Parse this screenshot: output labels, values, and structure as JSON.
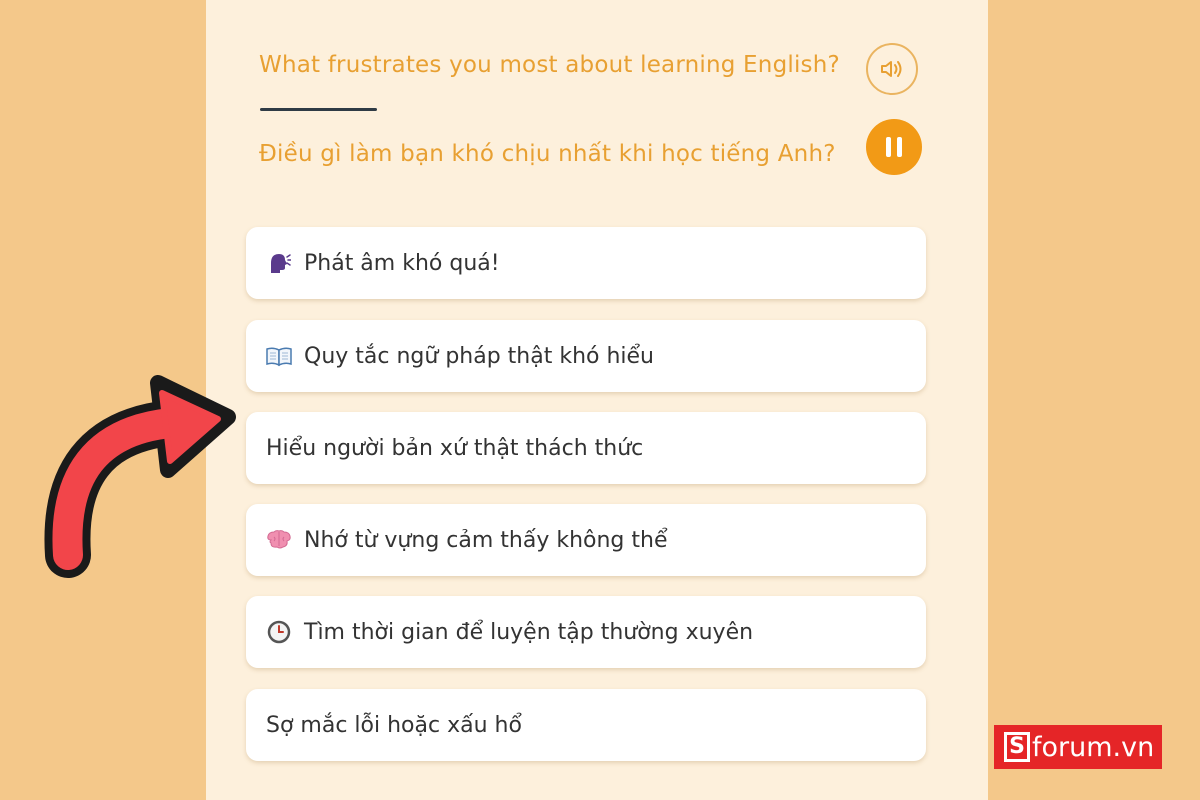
{
  "question": {
    "english": "What frustrates you most about learning English?",
    "vietnamese": "Điều gì làm bạn khó chịu nhất khi học tiếng Anh?"
  },
  "options": [
    {
      "icon": "speaking-head-icon",
      "label": "Phát âm khó quá!"
    },
    {
      "icon": "open-book-icon",
      "label": "Quy tắc ngữ pháp thật khó hiểu"
    },
    {
      "icon": "",
      "label": "Hiểu người bản xứ thật thách thức"
    },
    {
      "icon": "brain-icon",
      "label": "Nhớ từ vựng cảm thấy không thể"
    },
    {
      "icon": "clock-icon",
      "label": "Tìm thời gian để luyện tập thường xuyên"
    },
    {
      "icon": "",
      "label": "Sợ mắc lỗi hoặc xấu hổ"
    }
  ],
  "watermark": {
    "letter": "S",
    "text": "forum.vn"
  },
  "colors": {
    "background": "#f4c88a",
    "panel": "#fdf0dc",
    "question_text": "#e8a032",
    "pause_button": "#f29a16",
    "arrow": "#f2454a",
    "logo": "#e52527"
  }
}
